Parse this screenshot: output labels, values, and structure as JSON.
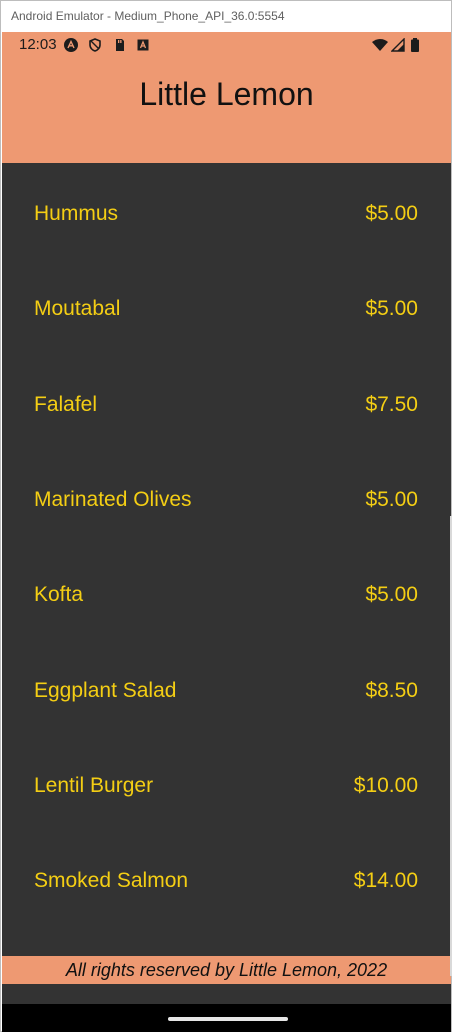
{
  "window": {
    "title": "Android Emulator - Medium_Phone_API_36.0:5554"
  },
  "status_bar": {
    "time": "12:03",
    "icons_left": [
      "a-logo-icon",
      "shield-icon",
      "sim-card-icon",
      "a-box-icon"
    ],
    "icons_right": [
      "wifi-icon",
      "signal-icon",
      "battery-icon"
    ]
  },
  "header": {
    "title": "Little Lemon"
  },
  "menu": {
    "items": [
      {
        "name": "Hummus",
        "price": "$5.00"
      },
      {
        "name": "Moutabal",
        "price": "$5.00"
      },
      {
        "name": "Falafel",
        "price": "$7.50"
      },
      {
        "name": "Marinated Olives",
        "price": "$5.00"
      },
      {
        "name": "Kofta",
        "price": "$5.00"
      },
      {
        "name": "Eggplant Salad",
        "price": "$8.50"
      },
      {
        "name": "Lentil Burger",
        "price": "$10.00"
      },
      {
        "name": "Smoked Salmon",
        "price": "$14.00"
      }
    ]
  },
  "footer": {
    "text": "All rights reserved by Little Lemon, 2022"
  },
  "colors": {
    "accent": "#EE9972",
    "background": "#333333",
    "item_text": "#F4CE14"
  }
}
